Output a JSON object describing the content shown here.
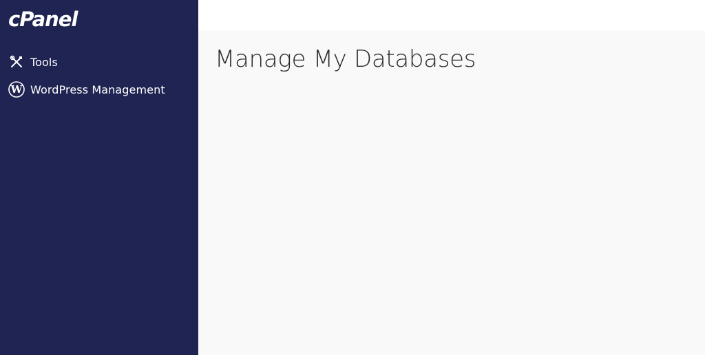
{
  "brand": {
    "logo_text": "cPanel"
  },
  "sidebar": {
    "items": [
      {
        "label": "Tools",
        "icon": "tools-icon"
      },
      {
        "label": "WordPress Management",
        "icon": "wordpress-icon"
      }
    ]
  },
  "main": {
    "title": "Manage My Databases"
  },
  "colors": {
    "sidebar_bg": "#1f2452",
    "main_bg": "#f9f9f9",
    "topbar_bg": "#ffffff",
    "title_text": "#2b2b2b"
  }
}
